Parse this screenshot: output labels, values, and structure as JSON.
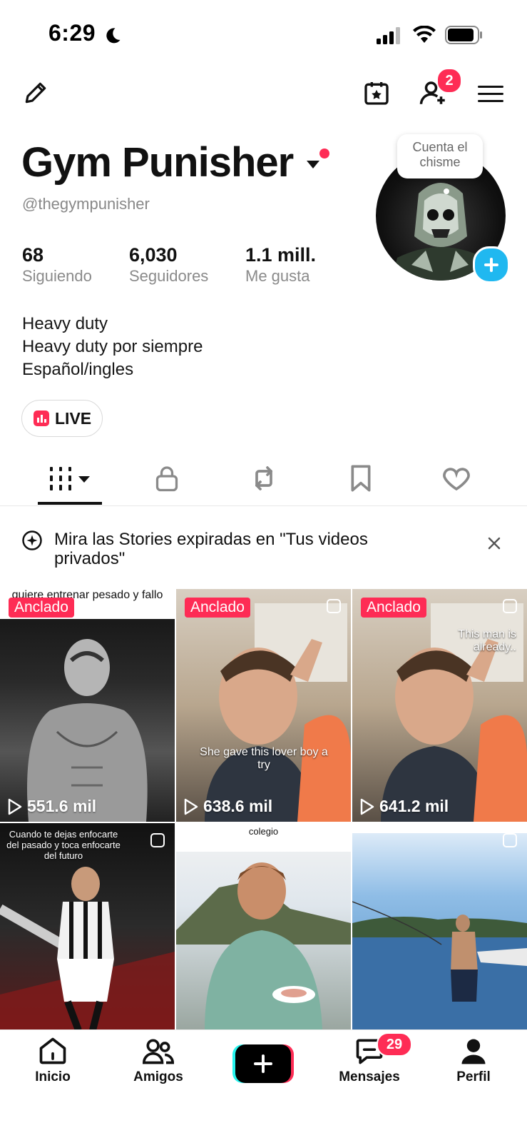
{
  "status": {
    "time": "6:29"
  },
  "header": {
    "notifications_badge": "2"
  },
  "tooltip": {
    "text_line1": "Cuenta el",
    "text_line2": "chisme"
  },
  "profile": {
    "name": "Gym Punisher",
    "handle": "@thegympunisher",
    "stats": [
      {
        "value": "68",
        "label": "Siguiendo"
      },
      {
        "value": "6,030",
        "label": "Seguidores"
      },
      {
        "value": "1.1 mill.",
        "label": "Me gusta"
      }
    ],
    "bio": [
      "Heavy duty",
      "Heavy duty por siempre",
      "Español/ingles"
    ],
    "live_label": "LIVE"
  },
  "stories_banner": {
    "text": "Mira las Stories expiradas en \"Tus videos privados\""
  },
  "videos": [
    {
      "pinned": "Anclado",
      "views": "551.6 mil",
      "caption": "quiere entrenar pesado y fallo"
    },
    {
      "pinned": "Anclado",
      "views": "638.6 mil",
      "caption": "She gave this lover boy a try"
    },
    {
      "pinned": "Anclado",
      "views": "641.2 mil",
      "caption": "This man is already.."
    },
    {
      "pinned": "",
      "views": "",
      "caption": "Cuando te dejas enfocarte del pasado y toca enfocarte del futuro"
    },
    {
      "pinned": "",
      "views": "",
      "caption": "colegio"
    },
    {
      "pinned": "",
      "views": "",
      "caption": ""
    }
  ],
  "bottom_nav": {
    "items": [
      {
        "label": "Inicio"
      },
      {
        "label": "Amigos"
      },
      {
        "label": ""
      },
      {
        "label": "Mensajes",
        "badge": "29"
      },
      {
        "label": "Perfil"
      }
    ]
  },
  "colors": {
    "accent": "#fe2c55",
    "cyan": "#25f4ee",
    "follow_plus": "#20b8f0"
  }
}
